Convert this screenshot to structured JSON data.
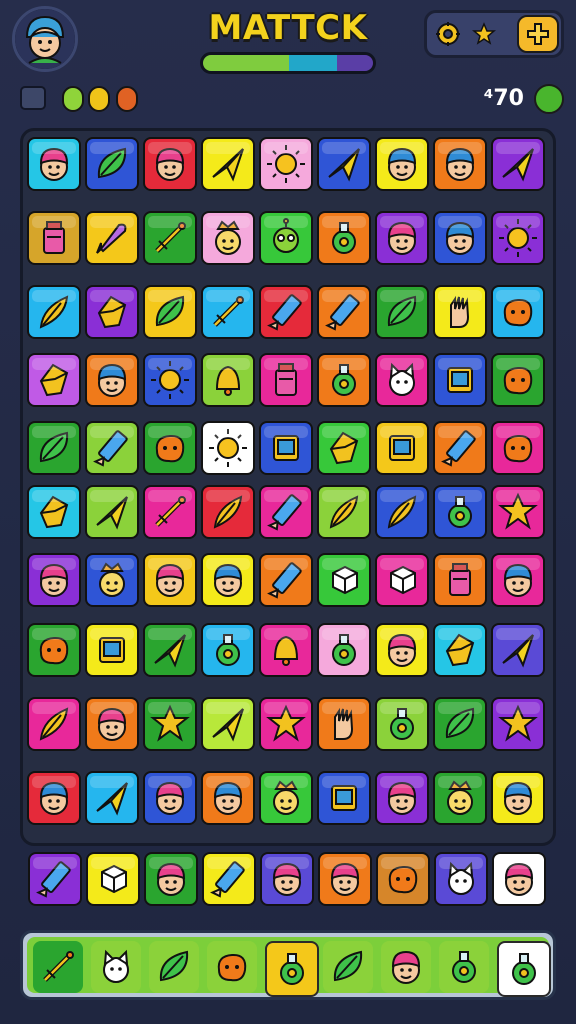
{
  "header": {
    "title": "MATTCK",
    "avatar_icon": "player-avatar-icon",
    "progress_colors": [
      "#7fcc3e",
      "#22a7c9",
      "#5a3ea6"
    ],
    "settings_icon": "gear-icon",
    "star_icon": "star-icon",
    "plus_icon": "plus-icon"
  },
  "status": {
    "score": "⁴70",
    "badge_colors": [
      "#8fd43a",
      "#f0c419",
      "#e06224"
    ]
  },
  "board": {
    "tiles": [
      [
        {
          "icon": "face-pink",
          "bg": "#25c6e6"
        },
        {
          "icon": "leaf",
          "bg": "#2f55d6"
        },
        {
          "icon": "face-pink",
          "bg": "#e52a3a"
        },
        {
          "icon": "plane",
          "bg": "#f4ea1a"
        },
        {
          "icon": "sun",
          "bg": "#f5a9dc"
        },
        {
          "icon": "plane",
          "bg": "#2f55d6"
        },
        {
          "icon": "face-blue",
          "bg": "#f4ea1a"
        },
        {
          "icon": "face-blue",
          "bg": "#f07a1a"
        },
        {
          "icon": "plane",
          "bg": "#8a2fd6"
        }
      ],
      [
        {
          "icon": "jar",
          "bg": "#d6a52a"
        },
        {
          "icon": "rocket",
          "bg": "#f4c81a"
        },
        {
          "icon": "sword",
          "bg": "#2aa52f"
        },
        {
          "icon": "face-crown",
          "bg": "#f5a9dc"
        },
        {
          "icon": "alien",
          "bg": "#37c83a"
        },
        {
          "icon": "potion",
          "bg": "#f07a1a"
        },
        {
          "icon": "face-pink",
          "bg": "#8a2fd6"
        },
        {
          "icon": "face-blue",
          "bg": "#2f55d6"
        },
        {
          "icon": "sun",
          "bg": "#8a2fd6"
        }
      ],
      [
        {
          "icon": "feather",
          "bg": "#25b6ee"
        },
        {
          "icon": "gem",
          "bg": "#8a2fd6"
        },
        {
          "icon": "leaf",
          "bg": "#f4c81a"
        },
        {
          "icon": "sword",
          "bg": "#25b6ee"
        },
        {
          "icon": "crayon",
          "bg": "#e52a3a"
        },
        {
          "icon": "crayon",
          "bg": "#f07a1a"
        },
        {
          "icon": "leaf",
          "bg": "#2aa52f"
        },
        {
          "icon": "glove",
          "bg": "#f4ea1a"
        },
        {
          "icon": "blob",
          "bg": "#25b6ee"
        }
      ],
      [
        {
          "icon": "gem",
          "bg": "#c05ae6"
        },
        {
          "icon": "face-blue",
          "bg": "#f07a1a"
        },
        {
          "icon": "sun",
          "bg": "#2f55d6"
        },
        {
          "icon": "bell",
          "bg": "#8bd23a"
        },
        {
          "icon": "jar",
          "bg": "#e8289a"
        },
        {
          "icon": "potion",
          "bg": "#f07a1a"
        },
        {
          "icon": "cat",
          "bg": "#e8289a"
        },
        {
          "icon": "book",
          "bg": "#2f55d6"
        },
        {
          "icon": "blob",
          "bg": "#2aa52f"
        }
      ],
      [
        {
          "icon": "leaf",
          "bg": "#2aa52f"
        },
        {
          "icon": "crayon",
          "bg": "#8bd23a"
        },
        {
          "icon": "blob",
          "bg": "#2aa52f"
        },
        {
          "icon": "sun",
          "bg": "#ffffff"
        },
        {
          "icon": "book",
          "bg": "#2f55d6"
        },
        {
          "icon": "gem",
          "bg": "#37c83a"
        },
        {
          "icon": "book",
          "bg": "#f4c81a"
        },
        {
          "icon": "crayon",
          "bg": "#f07a1a"
        },
        {
          "icon": "blob",
          "bg": "#e8289a"
        }
      ],
      [
        {
          "icon": "gem",
          "bg": "#25c6e6"
        },
        {
          "icon": "plane",
          "bg": "#8bd23a"
        },
        {
          "icon": "sword",
          "bg": "#e8289a"
        },
        {
          "icon": "feather",
          "bg": "#e52a3a"
        },
        {
          "icon": "crayon",
          "bg": "#e8289a"
        },
        {
          "icon": "feather",
          "bg": "#8bd23a"
        },
        {
          "icon": "feather",
          "bg": "#2f55d6"
        },
        {
          "icon": "potion",
          "bg": "#2f55d6"
        },
        {
          "icon": "star",
          "bg": "#e8289a"
        }
      ],
      [
        {
          "icon": "face-pink",
          "bg": "#8a2fd6"
        },
        {
          "icon": "face-crown",
          "bg": "#2f55d6"
        },
        {
          "icon": "face-pink",
          "bg": "#f4c81a"
        },
        {
          "icon": "face-blue",
          "bg": "#f4ea1a"
        },
        {
          "icon": "crayon",
          "bg": "#f07a1a"
        },
        {
          "icon": "cube",
          "bg": "#37c83a"
        },
        {
          "icon": "cube",
          "bg": "#e8289a"
        },
        {
          "icon": "jar",
          "bg": "#f07a1a"
        },
        {
          "icon": "face-blue",
          "bg": "#e8289a"
        }
      ],
      [
        {
          "icon": "blob",
          "bg": "#2aa52f"
        },
        {
          "icon": "book",
          "bg": "#f4ea1a"
        },
        {
          "icon": "plane",
          "bg": "#2aa52f"
        },
        {
          "icon": "potion",
          "bg": "#25b6ee"
        },
        {
          "icon": "bell",
          "bg": "#e8289a"
        },
        {
          "icon": "potion",
          "bg": "#f5a9dc"
        },
        {
          "icon": "face-pink",
          "bg": "#f4ea1a"
        },
        {
          "icon": "gem",
          "bg": "#25c6e6"
        },
        {
          "icon": "plane",
          "bg": "#5a4ad6"
        }
      ],
      [
        {
          "icon": "feather",
          "bg": "#e8289a"
        },
        {
          "icon": "face-pink",
          "bg": "#f07a1a"
        },
        {
          "icon": "star",
          "bg": "#2aa52f"
        },
        {
          "icon": "plane",
          "bg": "#b8e83a"
        },
        {
          "icon": "star",
          "bg": "#e8289a"
        },
        {
          "icon": "glove",
          "bg": "#f07a1a"
        },
        {
          "icon": "potion",
          "bg": "#8bd23a"
        },
        {
          "icon": "leaf",
          "bg": "#2aa52f"
        },
        {
          "icon": "star",
          "bg": "#8a2fd6"
        }
      ],
      [
        {
          "icon": "face-blue",
          "bg": "#e52a3a"
        },
        {
          "icon": "plane",
          "bg": "#25b6ee"
        },
        {
          "icon": "face-pink",
          "bg": "#2f55d6"
        },
        {
          "icon": "face-blue",
          "bg": "#f07a1a"
        },
        {
          "icon": "face-crown",
          "bg": "#37c83a"
        },
        {
          "icon": "book",
          "bg": "#2f55d6"
        },
        {
          "icon": "face-pink",
          "bg": "#8a2fd6"
        },
        {
          "icon": "face-crown",
          "bg": "#2aa52f"
        },
        {
          "icon": "face-blue",
          "bg": "#f4ea1a"
        }
      ],
      [
        {
          "icon": "crayon",
          "bg": "#8a2fd6"
        },
        {
          "icon": "cube",
          "bg": "#f4ea1a"
        },
        {
          "icon": "face-pink",
          "bg": "#2aa52f"
        },
        {
          "icon": "crayon",
          "bg": "#f4ea1a"
        },
        {
          "icon": "face-pink",
          "bg": "#5a4ad6"
        },
        {
          "icon": "face-pink",
          "bg": "#f07a1a"
        },
        {
          "icon": "blob",
          "bg": "#d6862a"
        },
        {
          "icon": "cat",
          "bg": "#5a4ad6"
        },
        {
          "icon": "face-pink",
          "bg": "#ffffff"
        }
      ]
    ]
  },
  "tray": {
    "slots": [
      {
        "icon": "sword",
        "bg": "#2aa52f"
      },
      {
        "icon": "cat",
        "bg": "#8bd23a"
      },
      {
        "icon": "leaf",
        "bg": "#8bd23a"
      },
      {
        "icon": "blob",
        "bg": "#8bd23a"
      },
      {
        "icon": "potion",
        "bg": "#f4c81a"
      },
      {
        "icon": "leaf",
        "bg": "#8bd23a"
      },
      {
        "icon": "face-pink",
        "bg": "#8bd23a"
      },
      {
        "icon": "potion",
        "bg": "#8bd23a"
      },
      {
        "icon": "potion",
        "bg": "#ffffff"
      }
    ]
  }
}
